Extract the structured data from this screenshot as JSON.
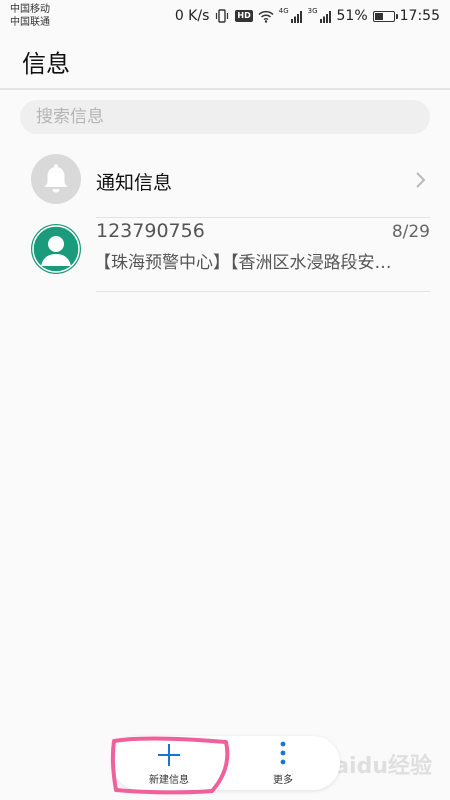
{
  "status_bar": {
    "carrier_1": "中国移动",
    "carrier_2": "中国联通",
    "net_speed": "0 K/s",
    "network_1": "4G",
    "network_2": "3G",
    "battery_percent": "51%",
    "battery_level": 0.51,
    "time": "17:55",
    "hd_label": "HD"
  },
  "header": {
    "title": "信息"
  },
  "search": {
    "placeholder": "搜索信息"
  },
  "conversations": [
    {
      "title": "通知信息",
      "icon": "bell-icon"
    },
    {
      "sender": "123790756",
      "date": "8/29",
      "preview": "【珠海预警中心】【香洲区水浸路段安…",
      "icon": "person-icon"
    }
  ],
  "bottom_bar": {
    "new_label": "新建信息",
    "more_label": "更多"
  },
  "colors": {
    "accent": "#1a73d9",
    "avatar_contact": "#1a9b7c",
    "avatar_bell": "#d9d9d9",
    "highlight": "#f0609a"
  },
  "watermark": {
    "text": "Baidu经验"
  }
}
